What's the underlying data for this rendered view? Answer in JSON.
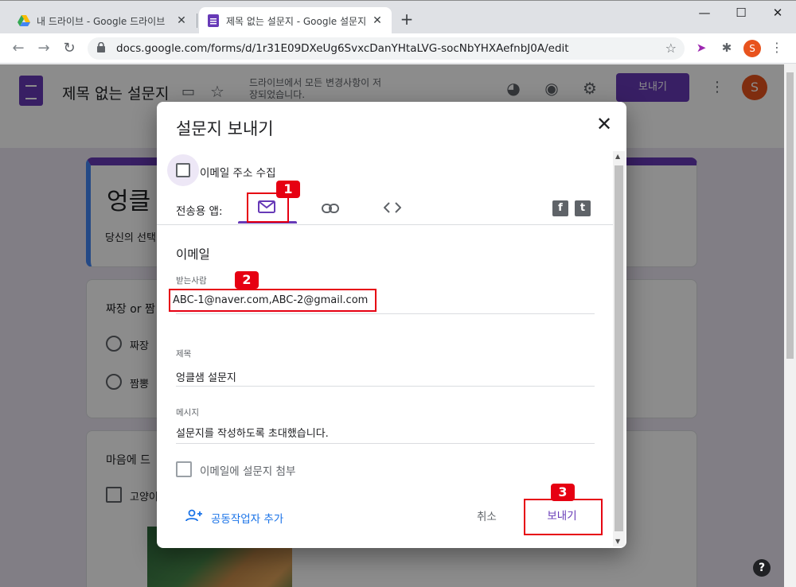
{
  "browser": {
    "tabs": [
      {
        "title": "내 드라이브 - Google 드라이브",
        "close": "✕",
        "icon": "google-drive-icon"
      },
      {
        "title": "제목 없는 설문지 - Google 설문지",
        "close": "✕",
        "icon": "google-forms-icon"
      }
    ],
    "new_tab": "+",
    "window_controls": {
      "minimize": "—",
      "maximize": "☐",
      "close": "✕"
    },
    "url": "docs.google.com/forms/d/1r31E09DXeUg6SvxcDanYHtaLVG-socNbYHXAefnbJ0A/edit",
    "profile_initial": "S"
  },
  "forms": {
    "doc_title": "제목 없는 설문지",
    "saved_status": "드라이브에서 모든 변경사항이 저장되었습니다.",
    "send_label": "보내기",
    "avatar_initial": "S",
    "form_heading": "엉클",
    "form_desc": "당신의 선택",
    "q1": {
      "text": "짜장 or 짬",
      "options": [
        "짜장",
        "짬뽕"
      ]
    },
    "q2": {
      "text": "마음에 드",
      "options": [
        "고양이"
      ]
    }
  },
  "dialog": {
    "title": "설문지 보내기",
    "close": "✕",
    "collect_email_label": "이메일 주소 수집",
    "send_via_label": "전송용 앱:",
    "via_tabs": [
      {
        "name": "email",
        "icon": "mail-icon",
        "active": true
      },
      {
        "name": "link",
        "icon": "link-icon",
        "active": false
      },
      {
        "name": "embed",
        "icon": "code-icon",
        "active": false
      }
    ],
    "social": {
      "facebook": "f",
      "twitter": "t"
    },
    "section_heading": "이메일",
    "to_label": "받는사람",
    "to_value": "ABC-1@naver.com,ABC-2@gmail.com",
    "subject_label": "제목",
    "subject_value": "엉클샘 설문지",
    "message_label": "메시지",
    "message_value": "설문지를 작성하도록 초대했습니다.",
    "attach_label": "이메일에 설문지 첨부",
    "add_collaborators": "공동작업자 추가",
    "cancel": "취소",
    "send": "보내기"
  },
  "annotations": [
    "1",
    "2",
    "3"
  ],
  "colors": {
    "accent": "#673ab7",
    "annotation_red": "#e60012",
    "link_blue": "#1a73e8"
  }
}
